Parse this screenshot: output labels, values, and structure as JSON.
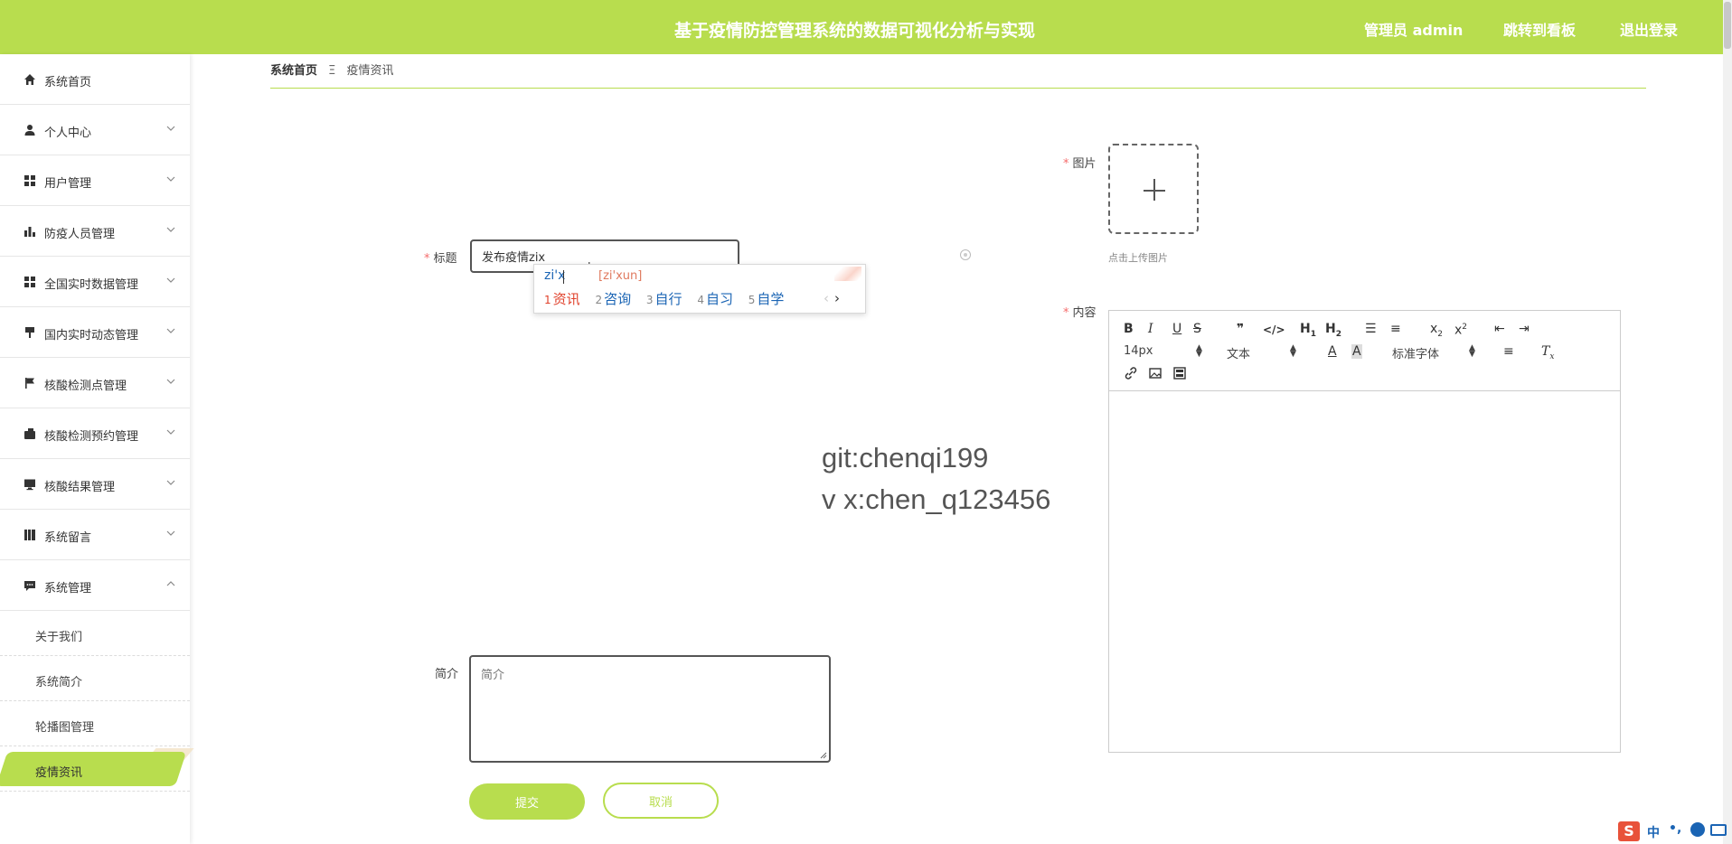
{
  "header": {
    "title": "基于疫情防控管理系统的数据可视化分析与实现",
    "user_label": "管理员 admin",
    "dashboard_link": "跳转到看板",
    "logout_link": "退出登录",
    "brand_color": "#b8dd4e"
  },
  "sidebar": {
    "items": [
      {
        "label": "系统首页",
        "icon": "home-icon"
      },
      {
        "label": "个人中心",
        "icon": "user-icon"
      },
      {
        "label": "用户管理",
        "icon": "grid-icon"
      },
      {
        "label": "防疫人员管理",
        "icon": "bar-chart-icon"
      },
      {
        "label": "全国实时数据管理",
        "icon": "grid-icon"
      },
      {
        "label": "国内实时动态管理",
        "icon": "pin-icon"
      },
      {
        "label": "核酸检测点管理",
        "icon": "flag-icon"
      },
      {
        "label": "核酸检测预约管理",
        "icon": "wallet-icon"
      },
      {
        "label": "核酸结果管理",
        "icon": "monitor-icon"
      },
      {
        "label": "系统留言",
        "icon": "book-icon"
      },
      {
        "label": "系统管理",
        "icon": "chat-icon"
      }
    ],
    "subitems": [
      {
        "label": "关于我们"
      },
      {
        "label": "系统简介"
      },
      {
        "label": "轮播图管理"
      },
      {
        "label": "疫情资讯"
      }
    ]
  },
  "breadcrumb": {
    "home": "系统首页",
    "separator": "Ξ",
    "current": "疫情资讯"
  },
  "form": {
    "title_label": "标题",
    "title_value": "发布疫情zix",
    "image_label": "图片",
    "upload_tip": "点击上传图片",
    "content_label": "内容",
    "intro_label": "简介",
    "intro_placeholder": "简介",
    "submit_label": "提交",
    "cancel_label": "取消"
  },
  "ime": {
    "pinyin": "zi'x",
    "hint": "[zi'xun]",
    "candidates": [
      {
        "n": "1",
        "text": "资讯"
      },
      {
        "n": "2",
        "text": "咨询"
      },
      {
        "n": "3",
        "text": "自行"
      },
      {
        "n": "4",
        "text": "自习"
      },
      {
        "n": "5",
        "text": "自学"
      }
    ]
  },
  "editor": {
    "font_size": "14px",
    "block_type": "文本",
    "font_family": "标准字体"
  },
  "watermark": {
    "line1": "git:chenqi199",
    "line2": "v x:chen_q123456"
  },
  "tray": {
    "input_mode": "中",
    "punctuation": "•,"
  }
}
